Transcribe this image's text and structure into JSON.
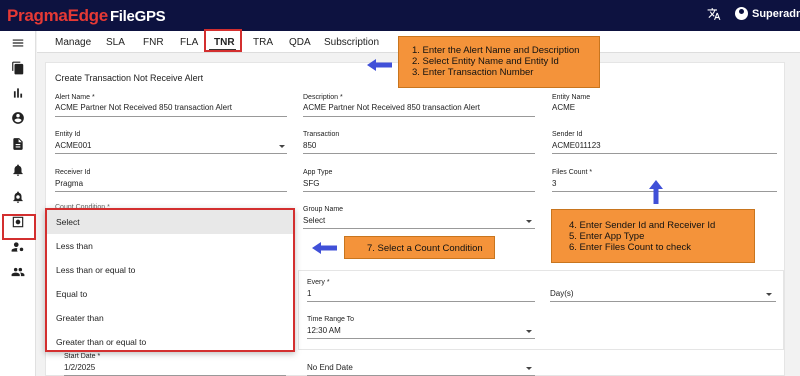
{
  "app": {
    "brand": "PragmaEdge",
    "product": "FileGPS",
    "user": "Superadmin"
  },
  "tabs": [
    "Manage",
    "SLA",
    "FNR",
    "FLA",
    "TNR",
    "TRA",
    "QDA",
    "Subscription"
  ],
  "form": {
    "title": "Create Transaction Not Receive Alert",
    "alert_name": {
      "label": "Alert Name *",
      "value": "ACME Partner Not Received 850 transaction Alert"
    },
    "description": {
      "label": "Description *",
      "value": "ACME Partner Not Received 850 transaction Alert"
    },
    "entity_name": {
      "label": "Entity Name",
      "value": "ACME"
    },
    "entity_id": {
      "label": "Entity Id",
      "value": "ACME001"
    },
    "transaction": {
      "label": "Transaction",
      "value": "850"
    },
    "sender_id": {
      "label": "Sender Id",
      "value": "ACME011123"
    },
    "receiver_id": {
      "label": "Receiver Id",
      "value": "Pragma"
    },
    "app_type": {
      "label": "App Type",
      "value": "SFG"
    },
    "files_count": {
      "label": "Files Count *",
      "value": "3"
    },
    "count_condition": {
      "label": "Count Condition *"
    },
    "group_name": {
      "label": "Group Name",
      "value": "Select"
    },
    "every": {
      "label": "Every *",
      "value": "1"
    },
    "every_unit": {
      "value": "Day(s)"
    },
    "time_range_to": {
      "label": "Time Range To",
      "value": "12:30 AM"
    },
    "start_date": {
      "label": "Start Date *",
      "value": "1/2/2025"
    },
    "end_date": {
      "value": "No End Date"
    }
  },
  "dropdown": {
    "options": [
      "Select",
      "Less than",
      "Less than or equal to",
      "Equal to",
      "Greater than",
      "Greater than or equal to"
    ],
    "selected": "Select"
  },
  "callouts": {
    "c1": [
      "1. Enter the Alert Name and Description",
      "2. Select Entity Name and Entity Id",
      "3. Enter Transaction Number"
    ],
    "c2": [
      "4. Enter Sender Id and Receiver Id",
      "5. Enter App Type",
      "6. Enter Files Count to check"
    ],
    "c3": [
      "7. Select a Count Condition"
    ]
  },
  "colors": {
    "topbar": "#0d1240",
    "brand_red": "#e53935",
    "highlight_red": "#d32f2f",
    "callout_orange": "#f4933a",
    "arrow_blue": "#4050d8"
  },
  "icons": [
    "menu-icon",
    "files-icon",
    "bar-chart-icon",
    "account-circle-icon",
    "document-icon",
    "alert-bell-icon",
    "alert-active-icon",
    "settings-box-icon",
    "user-settings-icon",
    "group-icon",
    "translate-icon",
    "user-icon"
  ]
}
